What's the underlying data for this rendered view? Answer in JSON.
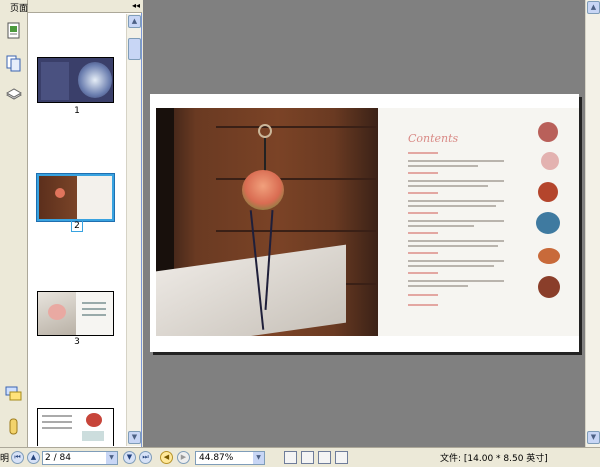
{
  "panel": {
    "title": "页面"
  },
  "thumbnails": [
    {
      "label": "1"
    },
    {
      "label": "2"
    },
    {
      "label": "3"
    },
    {
      "label": ""
    }
  ],
  "page_content": {
    "contents_title": "Contents"
  },
  "status": {
    "left_edge": "明",
    "page_indicator": "2 / 84",
    "zoom": "44.87%",
    "doc_size": "文件: [14.00 * 8.50 英寸]"
  },
  "icons": {
    "pages_tab": "page-icon",
    "bookmarks_tab": "layers-icon",
    "signatures_tab": "stack-icon",
    "comments_tab": "comments-icon",
    "attachments_tab": "paperclip-icon"
  },
  "colors": {
    "doc_bg": "#808080",
    "selection": "#39a3e0",
    "contents_title": "#d98a86"
  }
}
